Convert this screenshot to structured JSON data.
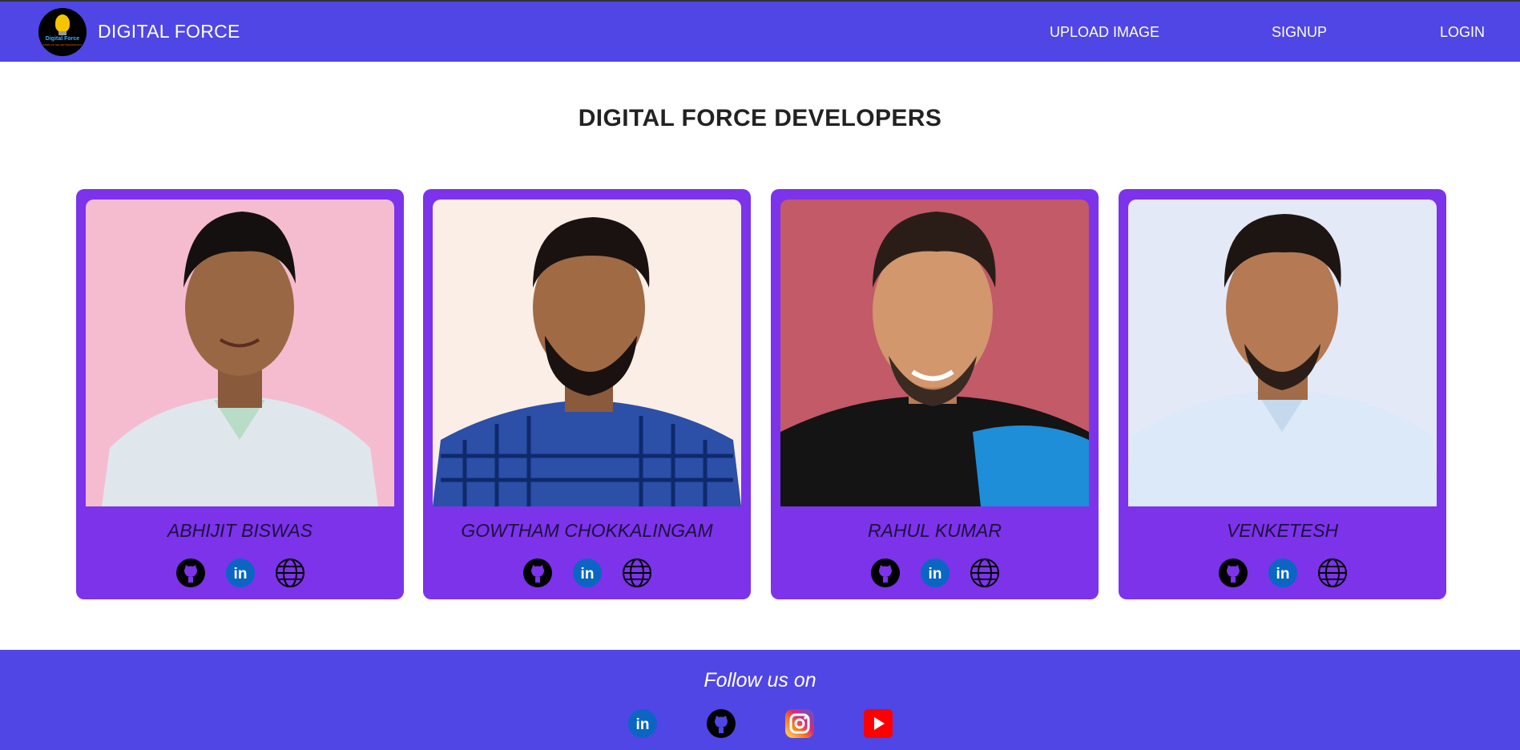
{
  "header": {
    "brand": "DIGITAL FORCE",
    "logo_text": "Digital Force",
    "logo_subtext": "STATE OF THE ART TECHNOLOGY",
    "nav": [
      "UPLOAD IMAGE",
      "SIGNUP",
      "LOGIN"
    ]
  },
  "main": {
    "title": "DIGITAL FORCE DEVELOPERS",
    "developers": [
      {
        "name": "ABHIJIT BISWAS",
        "photo_bg": "#f5bcd0"
      },
      {
        "name": "GOWTHAM CHOKKALINGAM",
        "photo_bg": "#fbeee6"
      },
      {
        "name": "RAHUL KUMAR",
        "photo_bg": "#c25a68"
      },
      {
        "name": "VENKETESH",
        "photo_bg": "#e4e9f7"
      }
    ],
    "social_icons": [
      "github-icon",
      "linkedin-icon",
      "globe-icon"
    ]
  },
  "footer": {
    "follow_text": "Follow us on",
    "icons": [
      "linkedin-icon",
      "github-icon",
      "instagram-icon",
      "youtube-icon"
    ]
  },
  "colors": {
    "nav_bg": "#4f46e5",
    "card_bg": "#7c33ea",
    "linkedin_blue": "#0a66c2",
    "youtube_red": "#ff0000"
  }
}
